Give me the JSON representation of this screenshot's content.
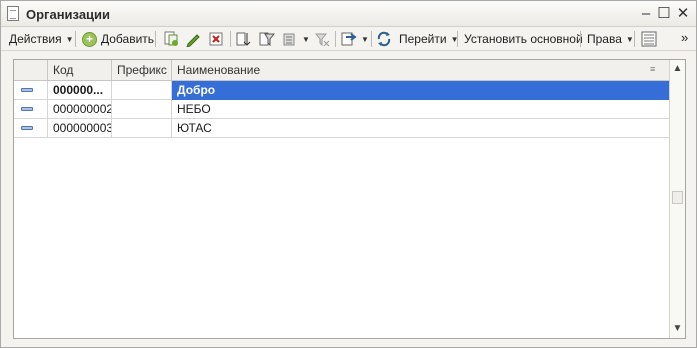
{
  "window": {
    "title": "Организации",
    "minimize": "–",
    "maximize": "☐",
    "close": "✕"
  },
  "toolbar": {
    "actions_label": "Действия",
    "add_label": "Добавить",
    "goto_label": "Перейти",
    "set_main_label": "Установить основной",
    "rights_label": "Права",
    "more_label": "»"
  },
  "table": {
    "columns": [
      "Код",
      "Префикс",
      "Наименование"
    ],
    "rows": [
      {
        "code": "000000...",
        "prefix": "",
        "name": "Добро"
      },
      {
        "code": "000000002",
        "prefix": "",
        "name": "НЕБО"
      },
      {
        "code": "000000003",
        "prefix": "",
        "name": "ЮТАС"
      }
    ]
  },
  "scroll": {
    "up": "▲",
    "down": "▼"
  }
}
